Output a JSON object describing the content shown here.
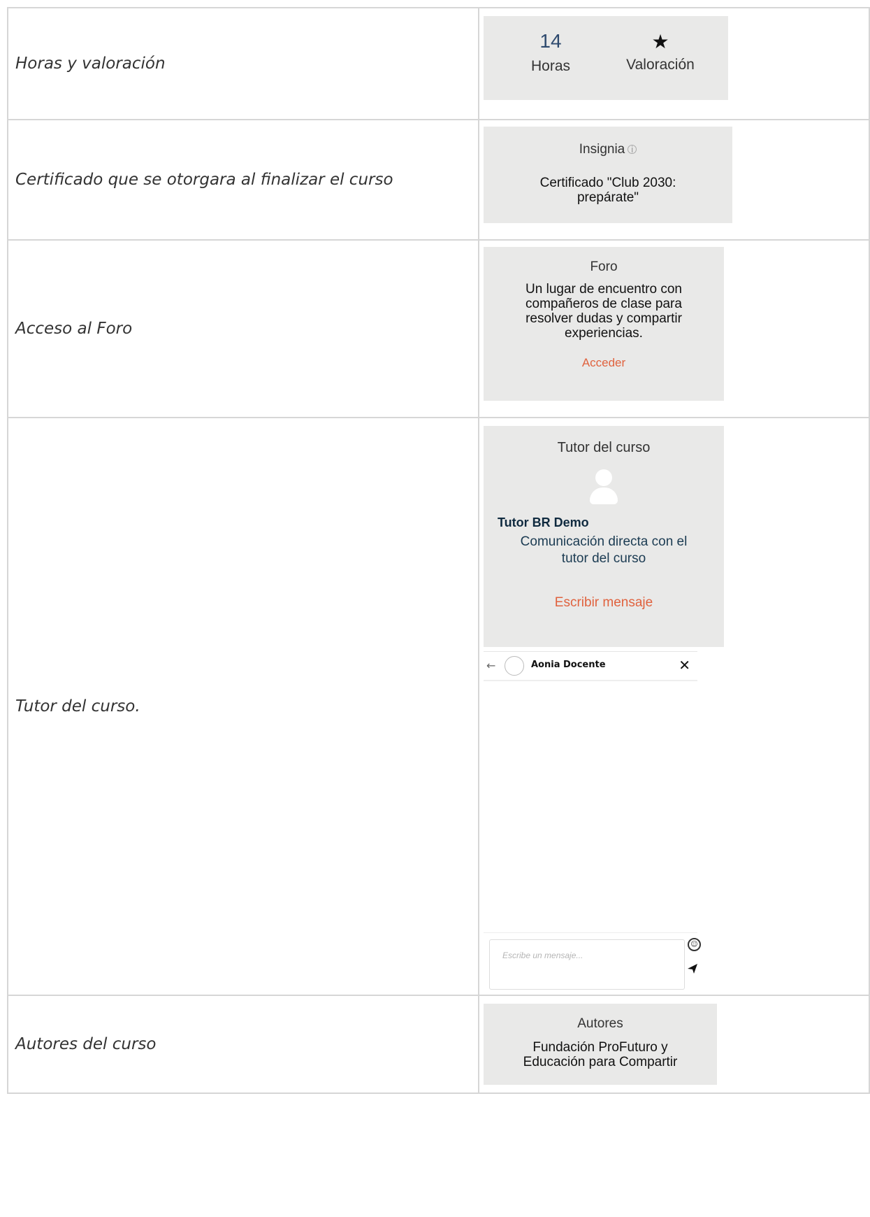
{
  "rows": [
    {
      "label": "Horas y valoración"
    },
    {
      "label": "Certificado que se otorgara al finalizar el curso"
    },
    {
      "label": "Acceso al Foro"
    },
    {
      "label": "Tutor del curso."
    },
    {
      "label": "Autores del curso"
    }
  ],
  "hours_panel": {
    "hours_value": "14",
    "hours_label": "Horas",
    "rating_label": "Valoración",
    "rating_icon": "star-icon"
  },
  "cert_panel": {
    "title": "Insignia",
    "body_line1": "Certificado \"Club 2030:",
    "body_line2": "prepárate\""
  },
  "foro_panel": {
    "title": "Foro",
    "body_line1": "Un lugar de encuentro con",
    "body_line2": "compañeros de clase para",
    "body_line3": "resolver dudas y compartir",
    "body_line4": "experiencias.",
    "link": "Acceder"
  },
  "tutor_panel": {
    "title": "Tutor del curso",
    "name": "Tutor BR Demo",
    "desc_line1": "Comunicación directa con el",
    "desc_line2": "tutor del curso",
    "link": "Escribir mensaje"
  },
  "chat": {
    "contact_name": "Aonia Docente",
    "input_placeholder": "Escribe un mensaje..."
  },
  "autores_panel": {
    "title": "Autores",
    "body_line1": "Fundación ProFuturo y",
    "body_line2": "Educación para Compartir"
  },
  "colors": {
    "panel_bg": "#e9e9e8",
    "accent_orange": "#e0623e",
    "number_blue": "#2e4a6e",
    "border": "#d6d6d6"
  }
}
